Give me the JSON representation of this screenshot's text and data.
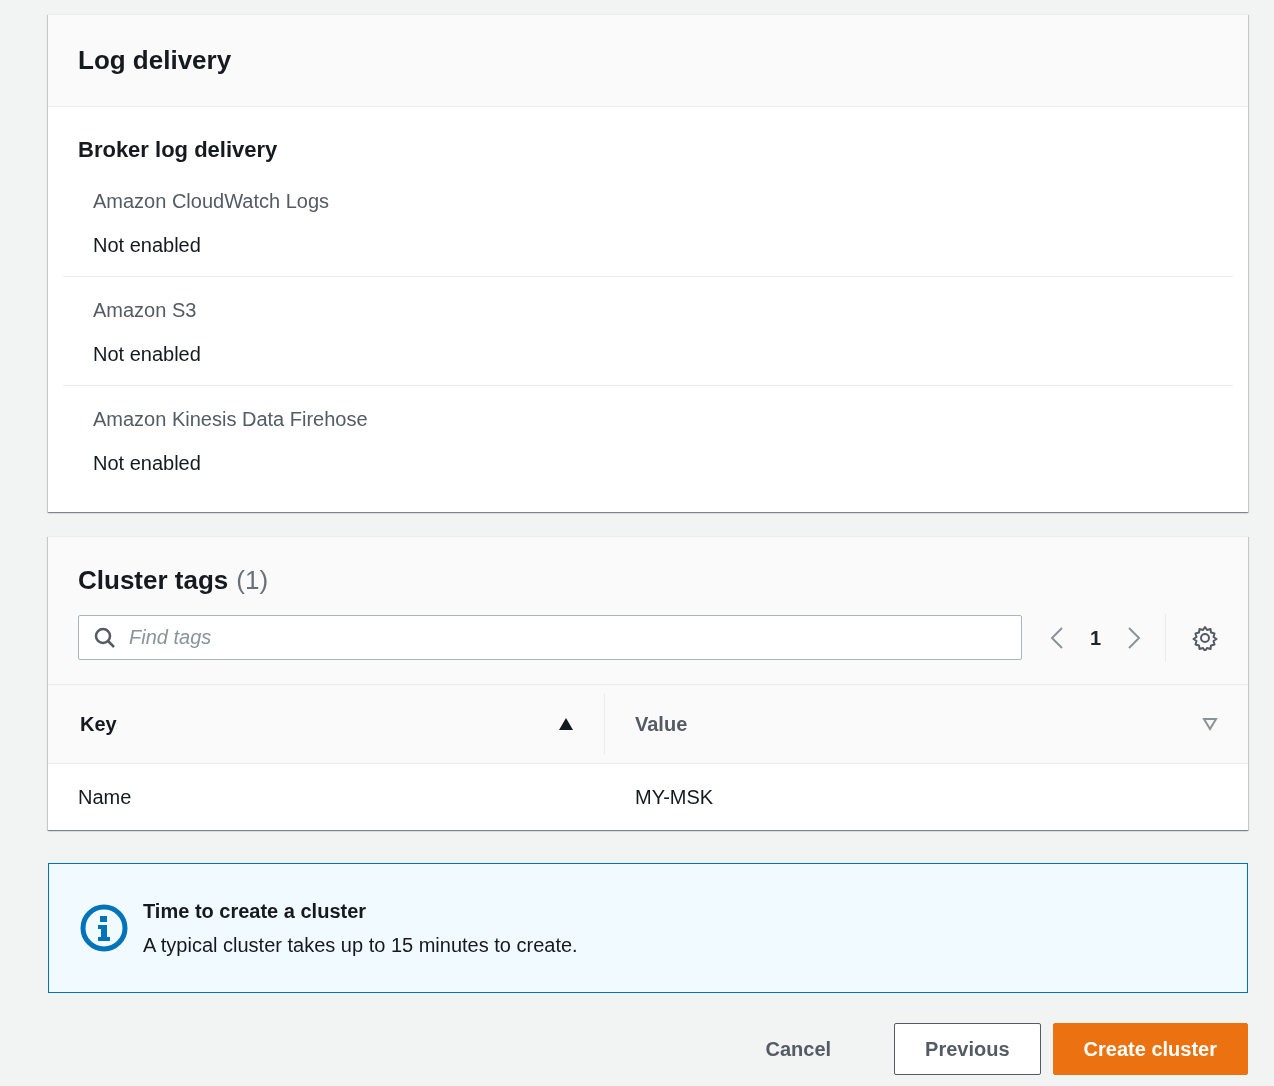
{
  "log_delivery": {
    "title": "Log delivery",
    "section_title": "Broker log delivery",
    "destinations": [
      {
        "label": "Amazon CloudWatch Logs",
        "value": "Not enabled"
      },
      {
        "label": "Amazon S3",
        "value": "Not enabled"
      },
      {
        "label": "Amazon Kinesis Data Firehose",
        "value": "Not enabled"
      }
    ]
  },
  "cluster_tags": {
    "title": "Cluster tags",
    "count": "(1)",
    "search": {
      "placeholder": "Find tags"
    },
    "page": "1",
    "columns": [
      {
        "label": "Key",
        "sorted": true
      },
      {
        "label": "Value",
        "sorted": false
      }
    ],
    "rows": [
      [
        "Name",
        "MY-MSK"
      ]
    ]
  },
  "info_alert": {
    "title": "Time to create a cluster",
    "message": "A typical cluster takes up to 15 minutes to create."
  },
  "buttons": [
    {
      "label": "Cancel",
      "kind": "link"
    },
    {
      "label": "Previous",
      "kind": "normal"
    },
    {
      "label": "Create cluster",
      "kind": "primary"
    }
  ]
}
